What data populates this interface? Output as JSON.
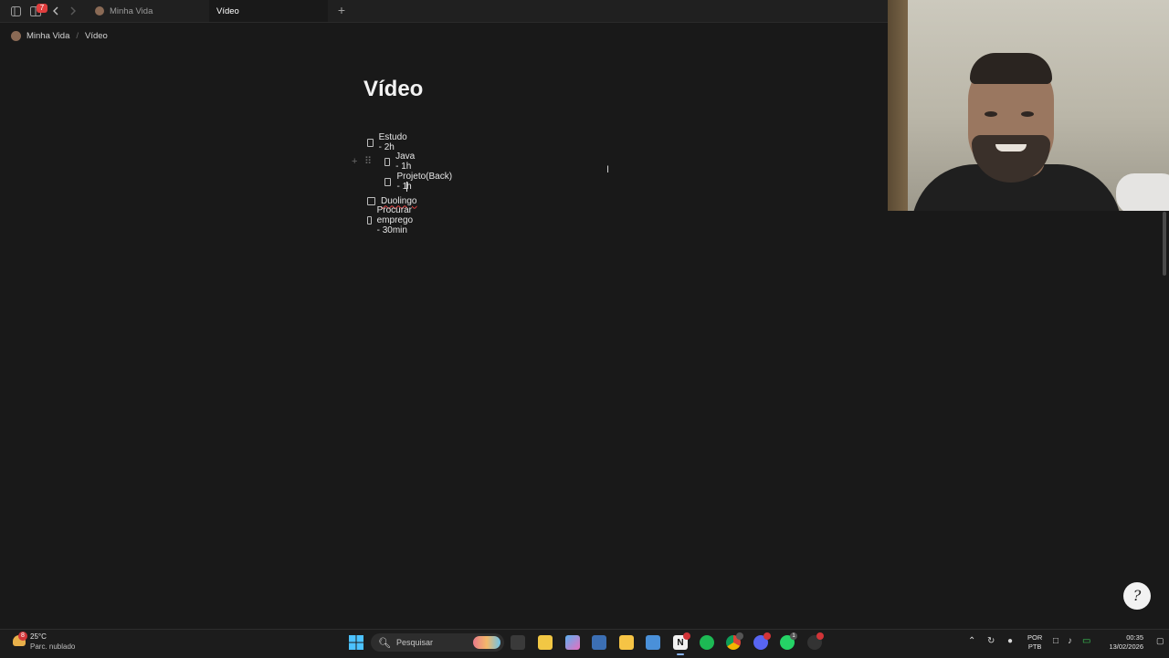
{
  "tabbar": {
    "notification_count": "7",
    "tabs": [
      {
        "label": "Minha Vida",
        "active": false
      },
      {
        "label": "Vídeo",
        "active": true
      }
    ],
    "new_tab_symbol": "+",
    "icons": [
      "sidebar-icon",
      "inbox-icon",
      "back-arrow-icon",
      "forward-arrow-icon",
      "plus-icon"
    ]
  },
  "breadcrumb": {
    "parent": "Minha Vida",
    "separator": "/",
    "current": "Vídeo"
  },
  "page": {
    "title": "Vídeo",
    "todos": [
      {
        "text": "Estudo - 2h",
        "checked": false,
        "indent": 0
      },
      {
        "text": "Java - 1h",
        "checked": false,
        "indent": 1
      },
      {
        "text_before_caret": "Projeto(Back) - 1",
        "text_after_caret": "h",
        "checked": false,
        "indent": 1
      },
      {
        "text": "Duolingo",
        "checked": false,
        "indent": 0,
        "spell_error": true
      },
      {
        "text": "Procurar emprego - 30min",
        "checked": false,
        "indent": 0
      }
    ],
    "block_handle_symbols": {
      "add": "+",
      "drag": "⠿"
    }
  },
  "help_button": {
    "glyph": "?"
  },
  "taskbar": {
    "weather": {
      "badge": "8",
      "temperature": "25°C",
      "condition": "Parc. nublado"
    },
    "search_placeholder": "Pesquisar",
    "app_badges": {
      "chrome": "",
      "discord": "",
      "whatsapp": "1"
    },
    "language": {
      "line1": "POR",
      "line2": "PTB"
    },
    "clock": {
      "time": "00:35",
      "date": "13/02/2026"
    }
  },
  "colors": {
    "background": "#191919",
    "text": "#e6e6e6",
    "badge_red": "#e03e3e",
    "taskbar": "#1c1c1c"
  }
}
